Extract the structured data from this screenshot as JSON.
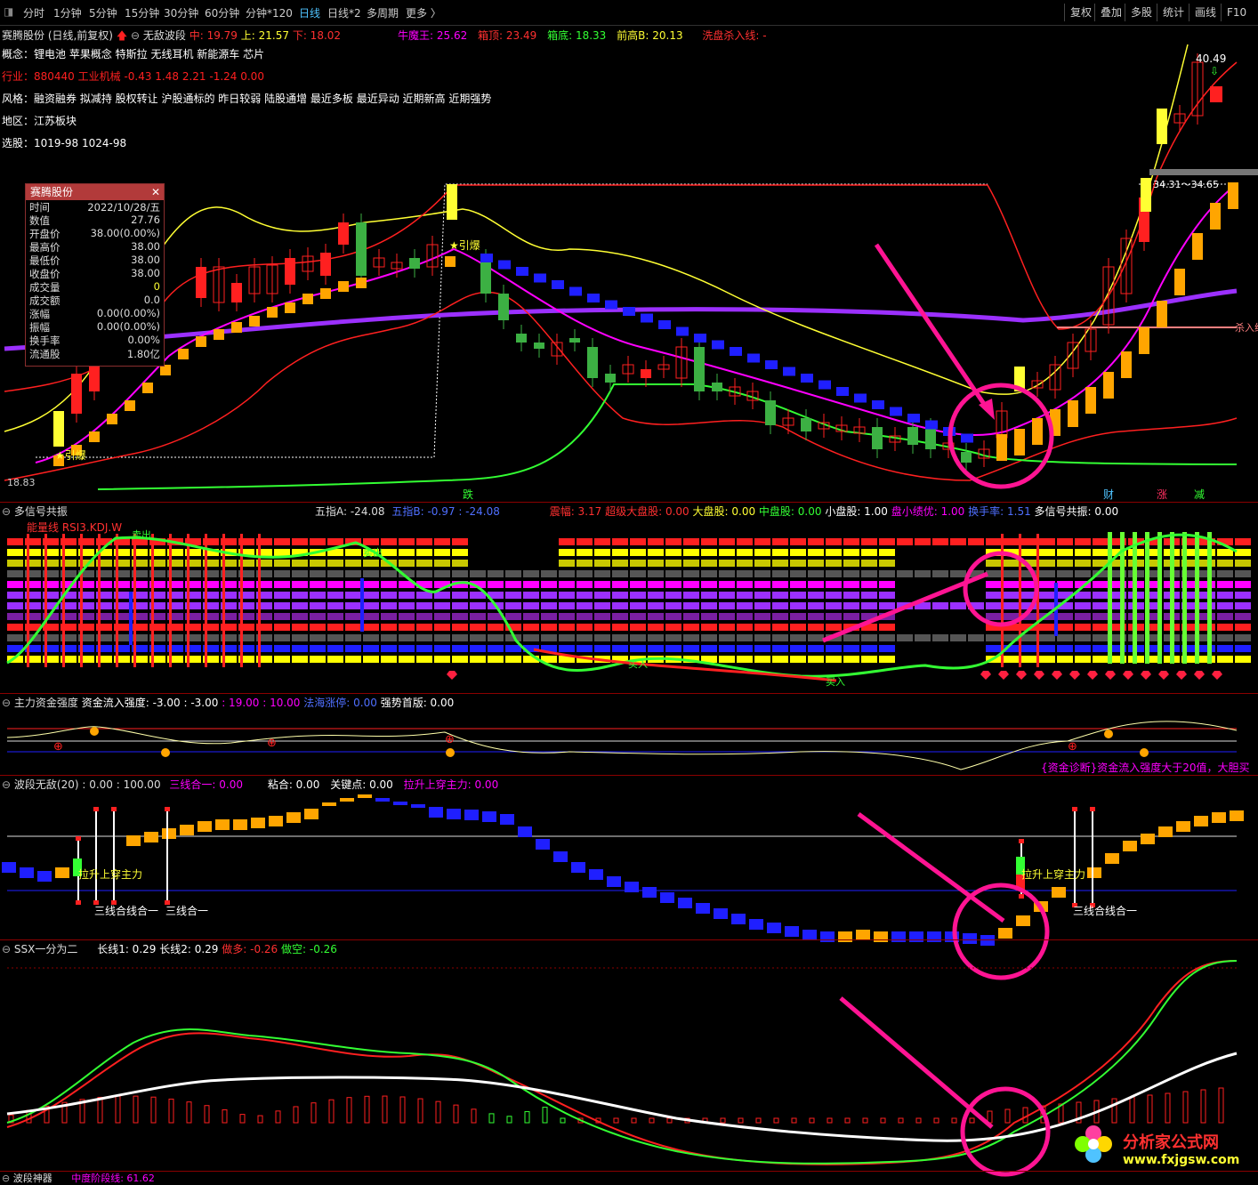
{
  "toolbar": {
    "items": [
      "分时",
      "1分钟",
      "5分钟",
      "15分钟",
      "30分钟",
      "60分钟",
      "分钟*120",
      "日线",
      "日线*2",
      "多周期",
      "更多 〉"
    ],
    "active": "日线",
    "right": [
      "复权",
      "叠加",
      "多股",
      "统计",
      "画线",
      "F10"
    ]
  },
  "header": {
    "stock": "赛腾股份 (日线,前复权)",
    "indicator": "无敌波段",
    "mid_label": "中: 19.79",
    "up_label": "上: 21.57",
    "down_label": "下: 18.02",
    "niu_mo_wang": "牛魔王: 25.62",
    "xiang_ding": "箱顶: 23.49",
    "xiang_di": "箱底: 18.33",
    "qian_gao_b": "前高B: 20.13",
    "xi_pan": "洗盘杀入线: -"
  },
  "info": {
    "concept": "概念：锂电池 苹果概念 特斯拉 无线耳机 新能源车 芯片",
    "industry": "行业：880440 工业机械 -0.43 1.48 2.21 -1.24 0.00",
    "style": "风格：融资融券 拟减持 股权转让 沪股通标的 昨日较弱 陆股通增 最近多板 最近异动 近期新高 近期强势",
    "region": "地区：江苏板块",
    "pick": "选股：1019-98 1024-98"
  },
  "popup": {
    "title": "赛腾股份",
    "rows": [
      {
        "label": "时间",
        "value": "2022/10/28/五"
      },
      {
        "label": "数值",
        "value": "27.76"
      },
      {
        "label": "开盘价",
        "value": "38.00(0.00%)"
      },
      {
        "label": "最高价",
        "value": "38.00"
      },
      {
        "label": "最低价",
        "value": "38.00"
      },
      {
        "label": "收盘价",
        "value": "38.00"
      },
      {
        "label": "成交量",
        "value": "0"
      },
      {
        "label": "成交额",
        "value": "0.0"
      },
      {
        "label": "涨幅",
        "value": "0.00(0.00%)"
      },
      {
        "label": "振幅",
        "value": "0.00(0.00%)"
      },
      {
        "label": "换手率",
        "value": "0.00%"
      },
      {
        "label": "流通股",
        "value": "1.80亿"
      }
    ]
  },
  "chart_labels": {
    "price_4049": "40.49",
    "price_range": "34.31～34.65",
    "price_1883": "18.83",
    "yinbao1": "★引爆",
    "yinbao2": "★引爆",
    "sharu": "杀入线",
    "die": "跌",
    "cai": "财",
    "zhang": "涨",
    "jian": "减"
  },
  "panel1": {
    "name": "多信号共振",
    "wuzhi_a": "五指A: -24.08",
    "wuzhi_b": "五指B: -0.97 : -24.08",
    "zhenfu": "震幅: 3.17",
    "chaoda": "超级大盘股: 0.00",
    "dapan": "大盘股: 0.00",
    "zhongpan": "中盘股: 0.00",
    "xiaopan": "小盘股: 1.00",
    "panxiao": "盘小绩优: 1.00",
    "huanshou": "换手率: 1.51",
    "duoxin": "多信号共振: 0.00",
    "legend": "能量线 RSI3.KDJ.W",
    "sell1": "卖出",
    "sell2": "卖出",
    "buy1": "买入",
    "buy2": "买入"
  },
  "panel2": {
    "name": "主力资金强度",
    "zjlr": "资金流入强度: -3.00 : -3.00",
    "v19": ": 19.00 : 10.00",
    "fahai": "法海涨停: 0.00",
    "qiangshi": "强势首版: 0.00",
    "diag": "{资金诊断}资金流入强度大于20值，大胆买"
  },
  "panel3": {
    "name": "波段无敌(20) : 0.00 : 100.00",
    "sanxian": "三线合一: 0.00",
    "nianhe": "粘合: 0.00",
    "guanjian": "关键点: 0.00",
    "lasheng": "拉升上穿主力: 0.00",
    "label_lasheng1": "拉升上穿主力",
    "label_lasheng2": "拉升上穿主力",
    "label_sx1": "三线合线合一",
    "label_sx2": "三线合一",
    "label_sx3": "三线合线合一"
  },
  "panel4": {
    "name": "SSX一分为二",
    "chang1": "长线1: 0.29",
    "chang2": "长线2: 0.29",
    "zuoduo": "做多: -0.26",
    "zuokong": "做空: -0.26"
  },
  "panel5": {
    "name": "波段神器",
    "sub": "中度阶段线: 61.62"
  },
  "watermark": {
    "cn": "分析家公式网",
    "url": "www.fxjgsw.com"
  },
  "colors": {
    "up": "#ff2020",
    "down": "#3cb043",
    "blue": "#1f1fff",
    "orange": "#ffa500",
    "yellow": "#ffff33",
    "purple": "#9b30ff",
    "magenta": "#ff1493",
    "green": "#33ff33"
  }
}
